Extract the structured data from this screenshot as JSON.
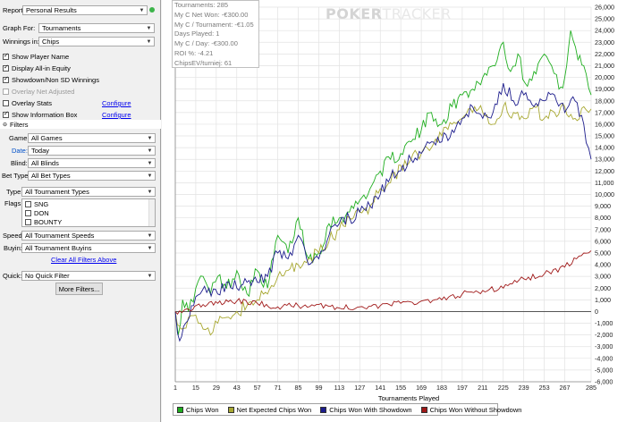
{
  "report": {
    "label": "Report:",
    "value": "Personal Results"
  },
  "graph_for": {
    "label": "Graph For:",
    "value": "Tournaments"
  },
  "winnings_in": {
    "label": "Winnings in:",
    "value": "Chips"
  },
  "options": {
    "show_player_name": "Show Player Name",
    "display_allin_equity": "Display All-in Equity",
    "showdown": "Showdown/Non SD Winnings",
    "overlay_net_adjusted": "Overlay Net Adjusted",
    "overlay_stats": "Overlay Stats",
    "show_info_box": "Show Information Box",
    "configure": "Configure"
  },
  "filters": {
    "header": "Filters",
    "game": {
      "label": "Game:",
      "value": "All Games"
    },
    "date": {
      "label": "Date:",
      "value": "Today"
    },
    "blind": {
      "label": "Blind:",
      "value": "All Blinds"
    },
    "bet_type": {
      "label": "Bet Type:",
      "value": "All Bet Types"
    },
    "type": {
      "label": "Type:",
      "value": "All Tournament Types"
    },
    "flags_label": "Flags:",
    "flags": [
      "SNG",
      "DON",
      "BOUNTY"
    ],
    "speed": {
      "label": "Speed:",
      "value": "All Tournament Speeds"
    },
    "buyin": {
      "label": "Buyin:",
      "value": "All Tournament Buyins"
    },
    "clear_all": "Clear All Filters Above",
    "quick": {
      "label": "Quick:",
      "value": "No Quick Filter"
    },
    "more_filters": "More Filters..."
  },
  "info_box": [
    "Tournaments: 285",
    "My C Net Won: -€300.00",
    "My C / Tournament: -€1.05",
    "Days Played: 1",
    "My C / Day: -€300.00",
    "ROI %: -4.21",
    "ChipsEV/turniej: 61"
  ],
  "watermark": {
    "bold": "POKER",
    "thin": "TRACKER"
  },
  "colors": {
    "green": "#1fae1f",
    "olive": "#a8a832",
    "navy": "#1c1c8c",
    "red": "#a01818"
  },
  "chart_data": {
    "type": "line",
    "xlabel": "Tournaments Played",
    "ylabel": "",
    "x_ticks": [
      1,
      15,
      29,
      43,
      57,
      71,
      85,
      99,
      113,
      127,
      141,
      155,
      169,
      183,
      197,
      211,
      225,
      239,
      253,
      267,
      285
    ],
    "y_ticks": [
      -6000,
      -5000,
      -4000,
      -3000,
      -2000,
      -1000,
      0,
      1000,
      2000,
      3000,
      4000,
      5000,
      6000,
      7000,
      8000,
      9000,
      10000,
      11000,
      12000,
      13000,
      14000,
      15000,
      16000,
      17000,
      18000,
      19000,
      20000,
      21000,
      22000,
      23000,
      24000,
      25000,
      26000
    ],
    "y_tick_labels": [
      "-6,000",
      "-5,000",
      "-4,000",
      "-3,000",
      "-2,000",
      "-1,000",
      "0",
      "1,000",
      "2,000",
      "3,000",
      "4,000",
      "5,000",
      "6,000",
      "7,000",
      "8,000",
      "9,000",
      "10,000",
      "11,000",
      "12,000",
      "13,000",
      "14,000",
      "15,000",
      "16,000",
      "17,000",
      "18,000",
      "19,000",
      "20,000",
      "21,000",
      "22,000",
      "23,000",
      "24,000",
      "25,000",
      "26,000"
    ],
    "xlim": [
      1,
      285
    ],
    "ylim": [
      -6000,
      26000
    ],
    "series": [
      {
        "name": "Chips Won",
        "color": "#1fae1f",
        "x": [
          1,
          3,
          6,
          10,
          15,
          20,
          25,
          30,
          36,
          43,
          50,
          57,
          64,
          71,
          78,
          85,
          92,
          99,
          106,
          113,
          120,
          127,
          134,
          141,
          148,
          155,
          162,
          169,
          176,
          183,
          190,
          197,
          204,
          211,
          218,
          225,
          230,
          235,
          240,
          246,
          253,
          258,
          263,
          267,
          271,
          276,
          280,
          285
        ],
        "y": [
          0,
          -2000,
          1000,
          0,
          2000,
          3000,
          1500,
          3000,
          2000,
          3500,
          1500,
          3500,
          2000,
          6500,
          5000,
          8000,
          4500,
          5000,
          7500,
          8000,
          8500,
          9500,
          10500,
          12000,
          13000,
          13500,
          14500,
          15500,
          17000,
          16000,
          17500,
          18500,
          19000,
          20000,
          21000,
          23000,
          20500,
          22000,
          19500,
          20500,
          22000,
          21000,
          19000,
          20000,
          24000,
          21500,
          21000,
          18500
        ]
      },
      {
        "name": "Net Expected Chips Won",
        "color": "#a8a832",
        "x": [
          1,
          5,
          10,
          15,
          20,
          25,
          30,
          36,
          43,
          50,
          57,
          64,
          71,
          78,
          85,
          92,
          99,
          106,
          113,
          120,
          127,
          134,
          141,
          148,
          155,
          162,
          169,
          176,
          183,
          190,
          197,
          204,
          211,
          218,
          225,
          232,
          239,
          246,
          253,
          260,
          267,
          274,
          280,
          285
        ],
        "y": [
          0,
          -1500,
          -500,
          -300,
          -1500,
          -2000,
          -1000,
          -500,
          0,
          500,
          1000,
          1500,
          3000,
          3500,
          4000,
          4500,
          5000,
          6000,
          7000,
          8000,
          8500,
          9000,
          10500,
          11000,
          12500,
          13000,
          13500,
          14000,
          15000,
          16000,
          16500,
          17000,
          17000,
          16000,
          17500,
          17000,
          16500,
          17500,
          16500,
          17000,
          17500,
          16500,
          17500,
          17300
        ]
      },
      {
        "name": "Chips Won With Showdown",
        "color": "#1c1c8c",
        "x": [
          1,
          4,
          8,
          12,
          18,
          24,
          30,
          36,
          43,
          50,
          57,
          64,
          71,
          78,
          85,
          92,
          99,
          106,
          113,
          120,
          127,
          134,
          141,
          148,
          155,
          162,
          169,
          176,
          183,
          190,
          197,
          204,
          211,
          218,
          225,
          232,
          239,
          246,
          253,
          260,
          267,
          274,
          280,
          285
        ],
        "y": [
          0,
          -2500,
          -1000,
          500,
          1500,
          2000,
          1500,
          2500,
          2000,
          2500,
          2500,
          3000,
          5000,
          4500,
          6500,
          4000,
          4500,
          6500,
          7500,
          8000,
          8500,
          9000,
          10000,
          11500,
          12000,
          13000,
          13500,
          14500,
          14500,
          15500,
          16500,
          17500,
          16500,
          17000,
          19500,
          18000,
          18500,
          17500,
          18000,
          18500,
          17000,
          18000,
          16000,
          13000
        ]
      },
      {
        "name": "Chips Won Without Showdown",
        "color": "#a01818",
        "x": [
          1,
          10,
          20,
          30,
          43,
          57,
          71,
          85,
          99,
          113,
          127,
          141,
          155,
          169,
          183,
          197,
          211,
          225,
          239,
          253,
          267,
          275,
          280,
          285
        ],
        "y": [
          0,
          200,
          600,
          700,
          900,
          700,
          400,
          500,
          600,
          300,
          400,
          500,
          700,
          900,
          1000,
          1500,
          1800,
          2000,
          2800,
          3200,
          3800,
          4500,
          5000,
          5200
        ]
      }
    ],
    "grid": "vertical and horizontal",
    "legend_position": "bottom"
  }
}
